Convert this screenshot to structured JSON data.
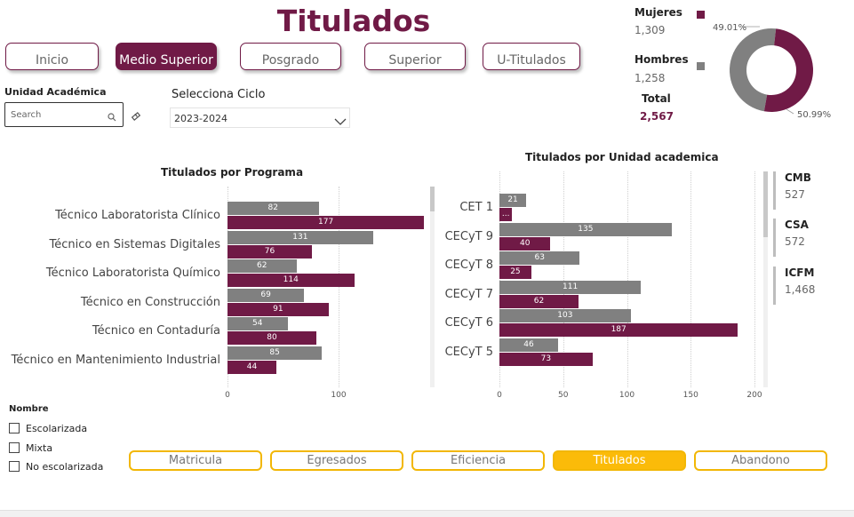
{
  "header": {
    "title": "Titulados"
  },
  "nav": {
    "items": [
      {
        "label": "Inicio",
        "active": false
      },
      {
        "label": "Medio Superior",
        "active": true
      },
      {
        "label": "Posgrado",
        "active": false
      },
      {
        "label": "Superior",
        "active": false
      },
      {
        "label": "U-Titulados",
        "active": false
      }
    ]
  },
  "unidad_slicer": {
    "label": "Unidad Académica",
    "placeholder": "Search"
  },
  "ciclo_slicer": {
    "label": "Selecciona Ciclo",
    "value": "2023-2024"
  },
  "gender": {
    "mujeres": {
      "label": "Mujeres",
      "value": "1,309",
      "color": "#701a46"
    },
    "hombres": {
      "label": "Hombres",
      "value": "1,258",
      "color": "#808080"
    },
    "total": {
      "label": "Total",
      "value": "2,567"
    },
    "donut": {
      "mujeres_pct": "50.99%",
      "hombres_pct": "49.01%"
    }
  },
  "colors": {
    "accent": "#701a46",
    "gray": "#808080",
    "yellow": "#fbbb09"
  },
  "chart_data": [
    {
      "type": "bar",
      "orientation": "horizontal",
      "title": "Titulados por Programa",
      "categories": [
        "Técnico Laboratorista Clínico",
        "Técnico en Sistemas Digitales",
        "Técnico Laboratorista Químico",
        "Técnico en Construcción",
        "Técnico en Contaduría",
        "Técnico en Mantenimiento Industrial"
      ],
      "series": [
        {
          "values": [
            82,
            131,
            62,
            69,
            54,
            85
          ],
          "color": "#808080"
        },
        {
          "values": [
            177,
            76,
            114,
            91,
            80,
            44
          ],
          "color": "#701a46"
        }
      ],
      "xlim": [
        0,
        180
      ],
      "xticks": [
        "0",
        "100"
      ],
      "grid": true
    },
    {
      "type": "bar",
      "orientation": "horizontal",
      "title": "Titulados por Unidad academica",
      "categories": [
        "CET 1",
        "CECyT 9",
        "CECyT 8",
        "CECyT 7",
        "CECyT 6",
        "CECyT 5"
      ],
      "series": [
        {
          "values": [
            21,
            135,
            63,
            111,
            103,
            46
          ],
          "color": "#808080"
        },
        {
          "values": [
            10,
            40,
            25,
            62,
            187,
            73
          ],
          "color": "#701a46"
        }
      ],
      "value_labels_red": [
        "...",
        "40",
        "25",
        "62",
        "187",
        "73"
      ],
      "xlim": [
        0,
        200
      ],
      "xticks": [
        "0",
        "50",
        "100",
        "150",
        "200"
      ],
      "grid": true
    }
  ],
  "cards": [
    {
      "label": "CMB",
      "value": "527"
    },
    {
      "label": "CSA",
      "value": "572"
    },
    {
      "label": "ICFM",
      "value": "1,468"
    }
  ],
  "nombre_filter": {
    "label": "Nombre",
    "options": [
      "Escolarizada",
      "Mixta",
      "No escolarizada"
    ]
  },
  "bottom_nav": {
    "items": [
      {
        "label": "Matricula",
        "active": false
      },
      {
        "label": "Egresados",
        "active": false
      },
      {
        "label": "Eficiencia",
        "active": false
      },
      {
        "label": "Titulados",
        "active": true
      },
      {
        "label": "Abandono",
        "active": false
      }
    ]
  }
}
